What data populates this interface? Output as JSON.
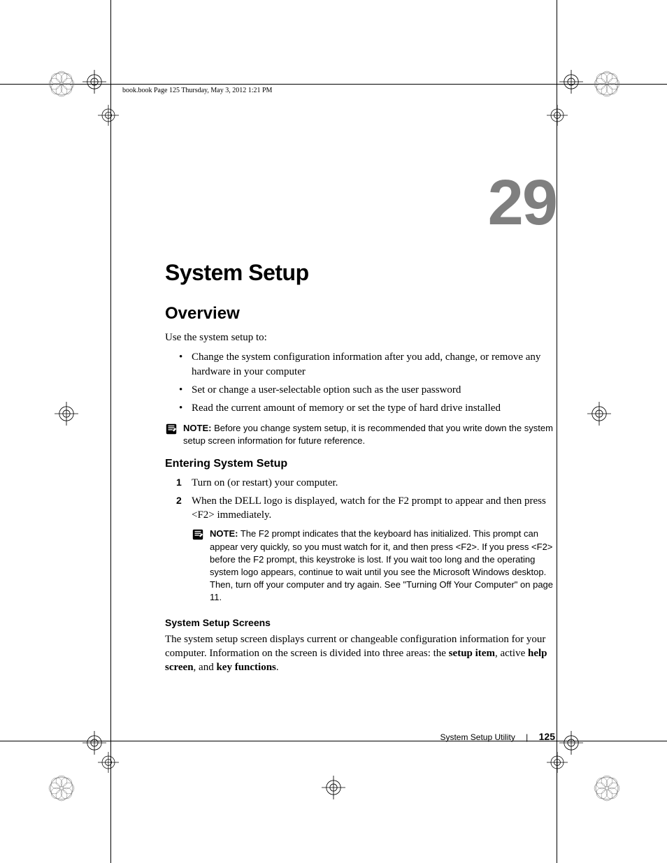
{
  "header": {
    "running": "book.book  Page 125  Thursday, May 3, 2012  1:21 PM"
  },
  "chapter": {
    "number": "29",
    "title": "System Setup"
  },
  "overview": {
    "heading": "Overview",
    "intro": "Use the system setup to:",
    "bullets": [
      "Change the system configuration information after you add, change, or remove any hardware in your computer",
      "Set or change a user-selectable option such as the user password",
      "Read the current amount of memory or set the type of hard drive installed"
    ]
  },
  "note1": {
    "label": "NOTE:",
    "text": " Before you change system setup, it is recommended that you write down the system setup screen information for future reference."
  },
  "entering": {
    "heading": "Entering System Setup",
    "steps": [
      "Turn on (or restart) your computer.",
      "When the DELL logo is displayed, watch for the F2 prompt to appear and then press <F2> immediately."
    ]
  },
  "note2": {
    "label": "NOTE:",
    "text": " The F2 prompt indicates that the keyboard has initialized. This prompt can appear very quickly, so you must watch for it, and then press <F2>. If you press <F2> before the F2 prompt, this keystroke is lost. If you wait too long and the operating system logo appears, continue to wait until you see the Microsoft Windows desktop. Then, turn off your computer and try again. See \"Turning Off Your Computer\" on page 11."
  },
  "screens": {
    "heading": "System Setup Screens",
    "para_a": "The system setup screen displays current or changeable configuration information for your computer. Information on the screen is divided into three areas: the ",
    "b1": "setup item",
    "mid1": ", active ",
    "b2": "help screen",
    "mid2": ", and ",
    "b3": "key functions",
    "tail": "."
  },
  "footer": {
    "section": "System Setup Utility",
    "page": "125"
  }
}
